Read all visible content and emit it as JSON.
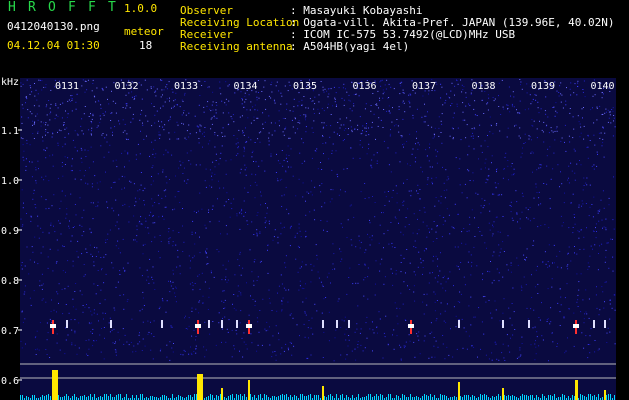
{
  "app": {
    "name_letters": [
      "H",
      "R",
      "O",
      "F",
      "F",
      "T"
    ],
    "version": "1.0.0"
  },
  "file": {
    "name": "0412040130.png",
    "datetime": "04.12.04 01:30",
    "meteor_label": "meteor",
    "meteor_count": "18"
  },
  "info": [
    {
      "label": "Observer",
      "value": ": Masayuki Kobayashi"
    },
    {
      "label": "Receiving Location",
      "value": ": Ogata-vill. Akita-Pref. JAPAN (139.96E, 40.02N)"
    },
    {
      "label": "Receiver",
      "value": ": ICOM IC-575 53.7492(@LCD)MHz USB"
    },
    {
      "label": "Receiving antenna",
      "value": ": A504HB(yagi 4el)"
    }
  ],
  "colors": {
    "brand": "#27d84a",
    "highlight": "#ffe600",
    "text": "#ffffff",
    "spectrum_bg": "#0a0a40",
    "signal": "#ffe600",
    "noise": "#00d8ff"
  },
  "spectrogram": {
    "y_unit": "kHz",
    "y_ticks": [
      "1.1",
      "1.0",
      "0.9",
      "0.8",
      "0.7",
      "0.6"
    ],
    "time_ticks": [
      "0131",
      "0132",
      "0133",
      "0134",
      "0135",
      "0136",
      "0137",
      "0138",
      "0139",
      "0140"
    ]
  }
}
